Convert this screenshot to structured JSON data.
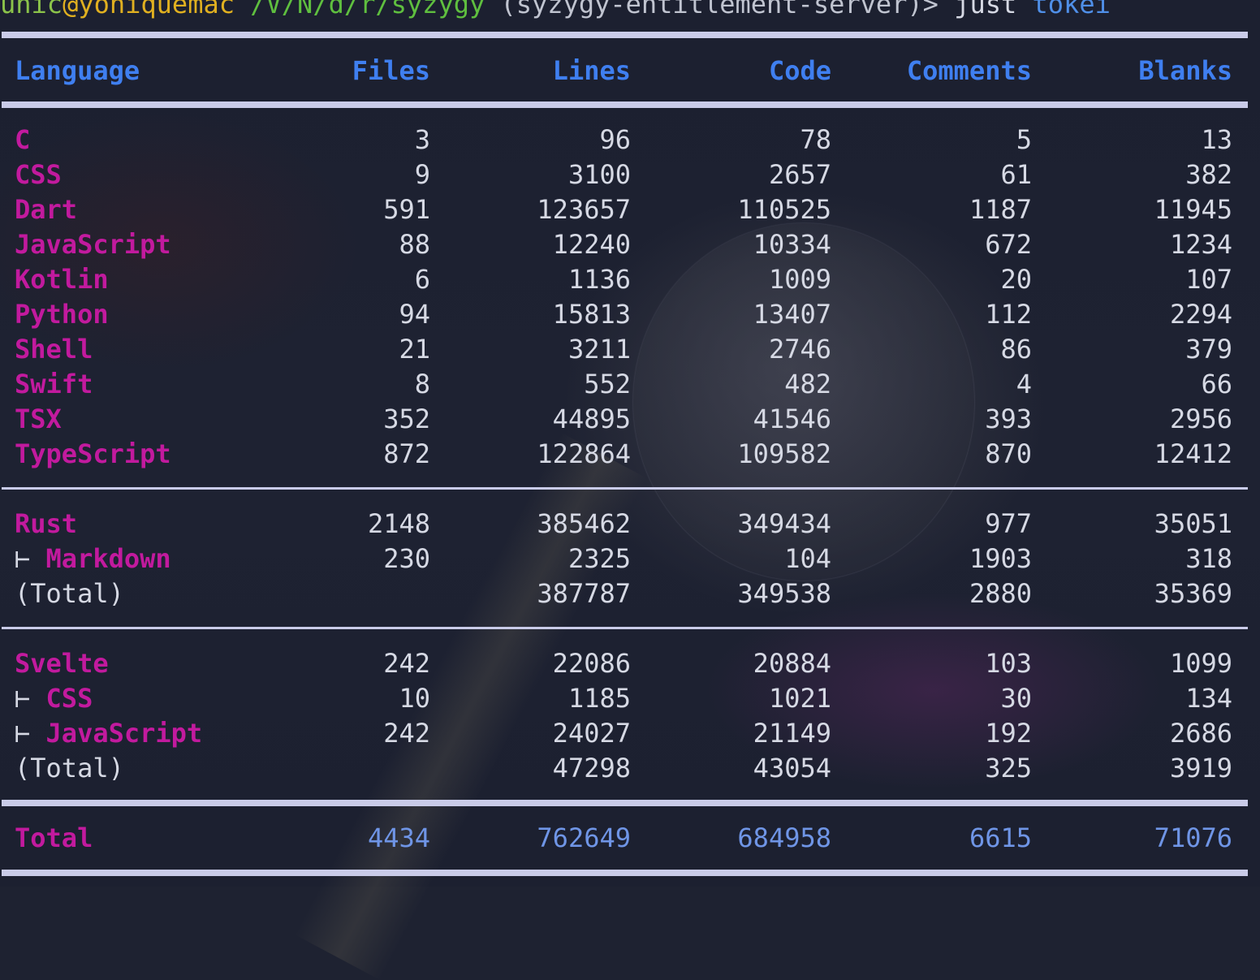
{
  "prompt": {
    "user": "unic",
    "at": "@",
    "host": "yoniquemac",
    "path": "/V/N/d/r/syzygy",
    "branch": "(syzygy-entitlement-server)>",
    "command": "just",
    "argument": "tokei"
  },
  "table": {
    "columns": [
      "Language",
      "Files",
      "Lines",
      "Code",
      "Comments",
      "Blanks"
    ],
    "languages": [
      {
        "name": "C",
        "files": "3",
        "lines": "96",
        "code": "78",
        "comments": "5",
        "blanks": "13"
      },
      {
        "name": "CSS",
        "files": "9",
        "lines": "3100",
        "code": "2657",
        "comments": "61",
        "blanks": "382"
      },
      {
        "name": "Dart",
        "files": "591",
        "lines": "123657",
        "code": "110525",
        "comments": "1187",
        "blanks": "11945"
      },
      {
        "name": "JavaScript",
        "files": "88",
        "lines": "12240",
        "code": "10334",
        "comments": "672",
        "blanks": "1234"
      },
      {
        "name": "Kotlin",
        "files": "6",
        "lines": "1136",
        "code": "1009",
        "comments": "20",
        "blanks": "107"
      },
      {
        "name": "Python",
        "files": "94",
        "lines": "15813",
        "code": "13407",
        "comments": "112",
        "blanks": "2294"
      },
      {
        "name": "Shell",
        "files": "21",
        "lines": "3211",
        "code": "2746",
        "comments": "86",
        "blanks": "379"
      },
      {
        "name": "Swift",
        "files": "8",
        "lines": "552",
        "code": "482",
        "comments": "4",
        "blanks": "66"
      },
      {
        "name": "TSX",
        "files": "352",
        "lines": "44895",
        "code": "41546",
        "comments": "393",
        "blanks": "2956"
      },
      {
        "name": "TypeScript",
        "files": "872",
        "lines": "122864",
        "code": "109582",
        "comments": "870",
        "blanks": "12412"
      }
    ],
    "rust": {
      "main": {
        "name": "Rust",
        "files": "2148",
        "lines": "385462",
        "code": "349434",
        "comments": "977",
        "blanks": "35051"
      },
      "sub": [
        {
          "prefix": "|-",
          "name": "Markdown",
          "files": "230",
          "lines": "2325",
          "code": "104",
          "comments": "1903",
          "blanks": "318"
        }
      ],
      "total": {
        "label": "(Total)",
        "lines": "387787",
        "code": "349538",
        "comments": "2880",
        "blanks": "35369"
      }
    },
    "svelte": {
      "main": {
        "name": "Svelte",
        "files": "242",
        "lines": "22086",
        "code": "20884",
        "comments": "103",
        "blanks": "1099"
      },
      "sub": [
        {
          "prefix": "|-",
          "name": "CSS",
          "files": "10",
          "lines": "1185",
          "code": "1021",
          "comments": "30",
          "blanks": "134"
        },
        {
          "prefix": "|-",
          "name": "JavaScript",
          "files": "242",
          "lines": "24027",
          "code": "21149",
          "comments": "192",
          "blanks": "2686"
        }
      ],
      "total": {
        "label": "(Total)",
        "lines": "47298",
        "code": "43054",
        "comments": "325",
        "blanks": "3919"
      }
    },
    "grand_total": {
      "name": "Total",
      "files": "4434",
      "lines": "762649",
      "code": "684958",
      "comments": "6615",
      "blanks": "71076"
    }
  }
}
